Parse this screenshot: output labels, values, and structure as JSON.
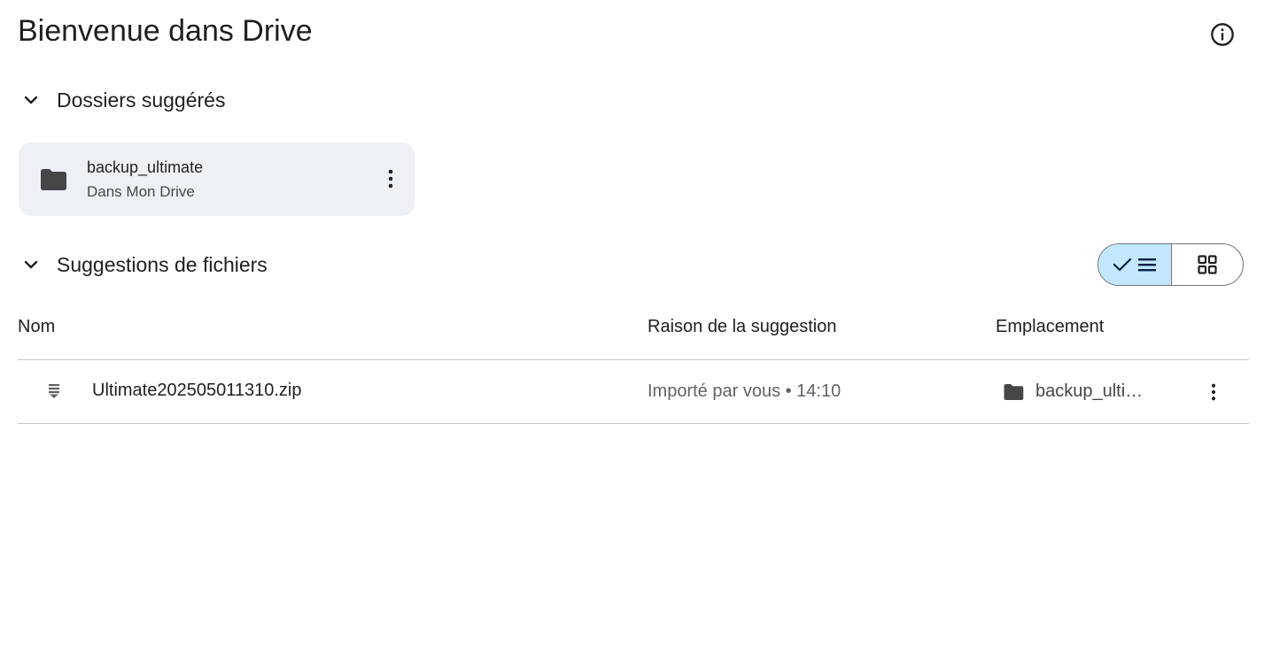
{
  "page": {
    "title": "Bienvenue dans Drive",
    "info_icon": "info-circle-icon"
  },
  "suggested_folders": {
    "heading": "Dossiers suggérés",
    "collapse_icon": "chevron-down-icon",
    "items": [
      {
        "name": "backup_ultimate",
        "location": "Dans Mon Drive",
        "icon": "folder-icon",
        "more_icon": "more-vertical-icon"
      }
    ]
  },
  "suggested_files": {
    "heading": "Suggestions de fichiers",
    "collapse_icon": "chevron-down-icon",
    "view_toggle": {
      "list_selected": true,
      "list_icons": [
        "check-icon",
        "list-icon"
      ],
      "grid_icon": "grid-icon"
    },
    "columns": [
      "Nom",
      "Raison de la suggestion",
      "Emplacement"
    ],
    "rows": [
      {
        "name": "Ultimate202505011310.zip",
        "icon": "zip-file-icon",
        "reason": "Importé par vous • 14:10",
        "location": "backup_ulti…",
        "location_icon": "folder-icon",
        "more_icon": "more-vertical-icon"
      }
    ]
  },
  "colors": {
    "accent": "#c2e7ff",
    "card_bg": "#edf1f6",
    "icon": "#444746",
    "divider": "#c7c7c7"
  }
}
